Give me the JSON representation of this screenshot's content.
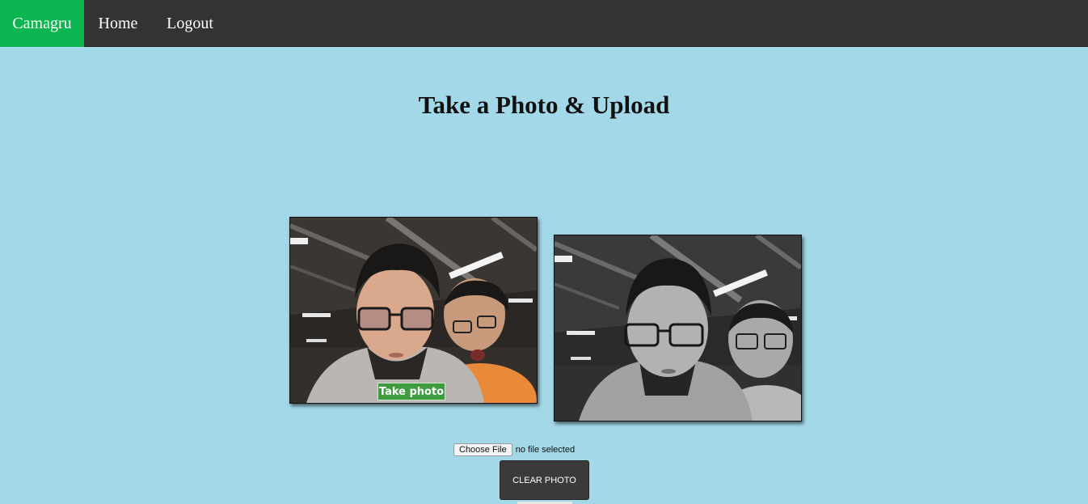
{
  "nav": {
    "brand": "Camagru",
    "home": "Home",
    "logout": "Logout",
    "brand_color": "#0bb550",
    "bar_color": "#333333"
  },
  "page": {
    "title": "Take a Photo & Upload",
    "background": "#a3d8e8"
  },
  "camera": {
    "take_photo_label": "Take photo"
  },
  "upload": {
    "choose_file_label": "Choose File",
    "file_status": "no file selected"
  },
  "actions": {
    "clear_photo_label": "CLEAR PHOTO"
  }
}
